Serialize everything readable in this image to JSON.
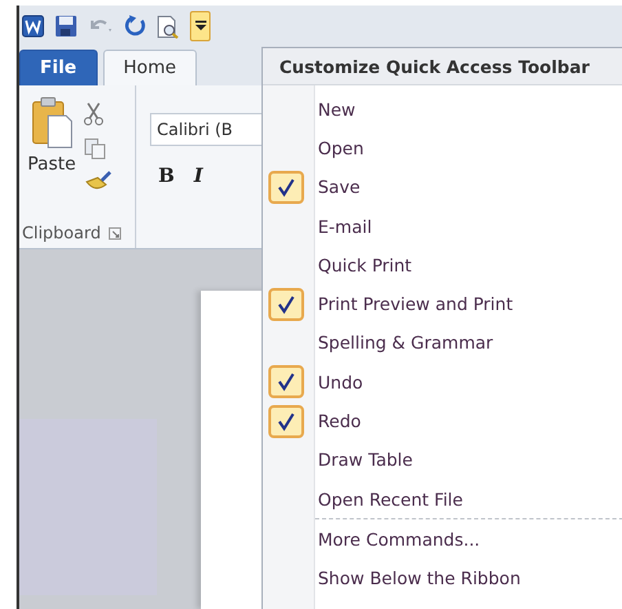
{
  "quick_access_toolbar": {
    "customize_button": {
      "selected": true
    }
  },
  "tabs": [
    {
      "label": "File",
      "kind": "file",
      "selected": false
    },
    {
      "label": "Home",
      "kind": "tab",
      "selected": true
    }
  ],
  "ribbon": {
    "clipboard": {
      "paste_label": "Paste",
      "group_label": "Clipboard"
    },
    "font": {
      "font_name": "Calibri (B",
      "bold": "B",
      "italic": "I"
    }
  },
  "menu": {
    "title": "Customize Quick Access Toolbar",
    "items": [
      {
        "label": "New",
        "kind": "toggle",
        "checked": false
      },
      {
        "label": "Open",
        "kind": "toggle",
        "checked": false
      },
      {
        "label": "Save",
        "kind": "toggle",
        "checked": true
      },
      {
        "label": "E-mail",
        "kind": "toggle",
        "checked": false
      },
      {
        "label": "Quick Print",
        "kind": "toggle",
        "checked": false
      },
      {
        "label": "Print Preview and Print",
        "kind": "toggle",
        "checked": true
      },
      {
        "label": "Spelling & Grammar",
        "kind": "toggle",
        "checked": false
      },
      {
        "label": "Undo",
        "kind": "toggle",
        "checked": true
      },
      {
        "label": "Redo",
        "kind": "toggle",
        "checked": true
      },
      {
        "label": "Draw Table",
        "kind": "toggle",
        "checked": false
      },
      {
        "label": "Open Recent File",
        "kind": "toggle",
        "checked": false
      },
      {
        "label": "More Commands...",
        "kind": "command"
      },
      {
        "label": "Show Below the Ribbon",
        "kind": "command"
      }
    ]
  }
}
